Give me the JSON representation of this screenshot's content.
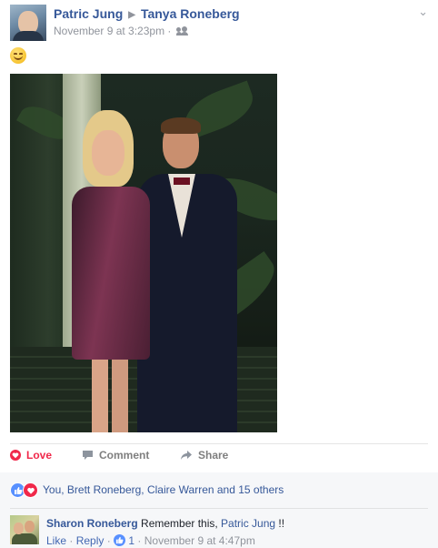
{
  "post": {
    "author": "Patric Jung",
    "target": "Tanya Roneberg",
    "timestamp": "November 9 at 3:23pm",
    "separator": " · ",
    "audience_icon": "friends-icon",
    "menu_icon": "chevron-down-icon",
    "status_icon": "smiling-face-emoji"
  },
  "actions": {
    "love_label": "Love",
    "comment_label": "Comment",
    "share_label": "Share"
  },
  "reactions": {
    "types": [
      "like",
      "love"
    ],
    "summary": "You, Brett Roneberg, Claire Warren and 15 others"
  },
  "comments": [
    {
      "author": "Sharon Roneberg",
      "text_before": " Remember this, ",
      "mention": "Patric Jung",
      "text_after": " !!",
      "like_label": "Like",
      "dot": " · ",
      "reply_label": "Reply",
      "like_count": "1",
      "timestamp": "November 9 at 4:47pm"
    }
  ],
  "colors": {
    "link": "#365899",
    "love": "#f0284a",
    "like": "#5890ff",
    "meta": "#90949c"
  }
}
